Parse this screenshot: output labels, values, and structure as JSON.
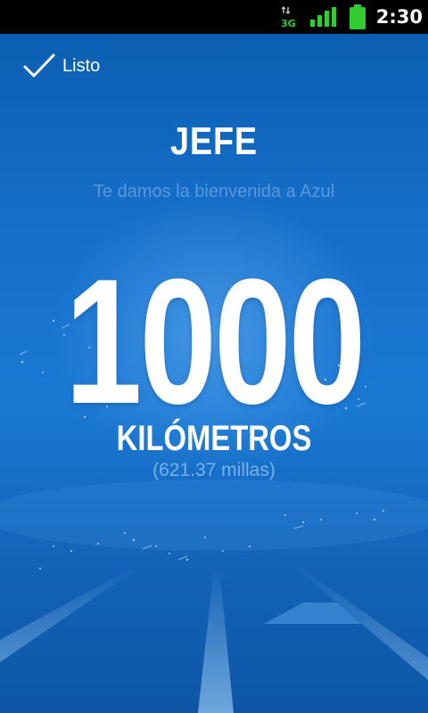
{
  "status_bar": {
    "network": "3G",
    "time": "2:30"
  },
  "toolbar": {
    "done_label": "Listo"
  },
  "welcome": {
    "name": "JEFE",
    "message": "Te damos la bienvenida a Azul"
  },
  "milestone": {
    "value": "1000",
    "unit": "KILÓMETROS",
    "conversion": "(621.37 millas)"
  },
  "colors": {
    "background": "#1a78d3",
    "status_bar": "#000000",
    "signal": "#33cc33"
  }
}
